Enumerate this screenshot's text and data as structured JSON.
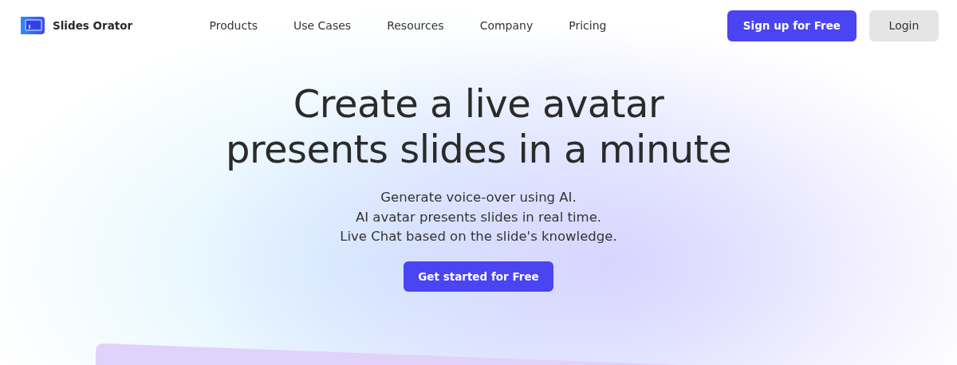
{
  "brand": {
    "name": "Slides Orator"
  },
  "nav": {
    "links": [
      "Products",
      "Use Cases",
      "Resources",
      "Company",
      "Pricing"
    ],
    "signup": "Sign up for Free",
    "login": "Login"
  },
  "hero": {
    "title_lines": [
      "Create a live avatar",
      "presents slides in a minute"
    ],
    "subtitle_lines": [
      "Generate voice-over using AI.",
      "AI avatar presents slides in real time.",
      "Live Chat based on the slide's knowledge."
    ],
    "cta": "Get started for Free"
  }
}
